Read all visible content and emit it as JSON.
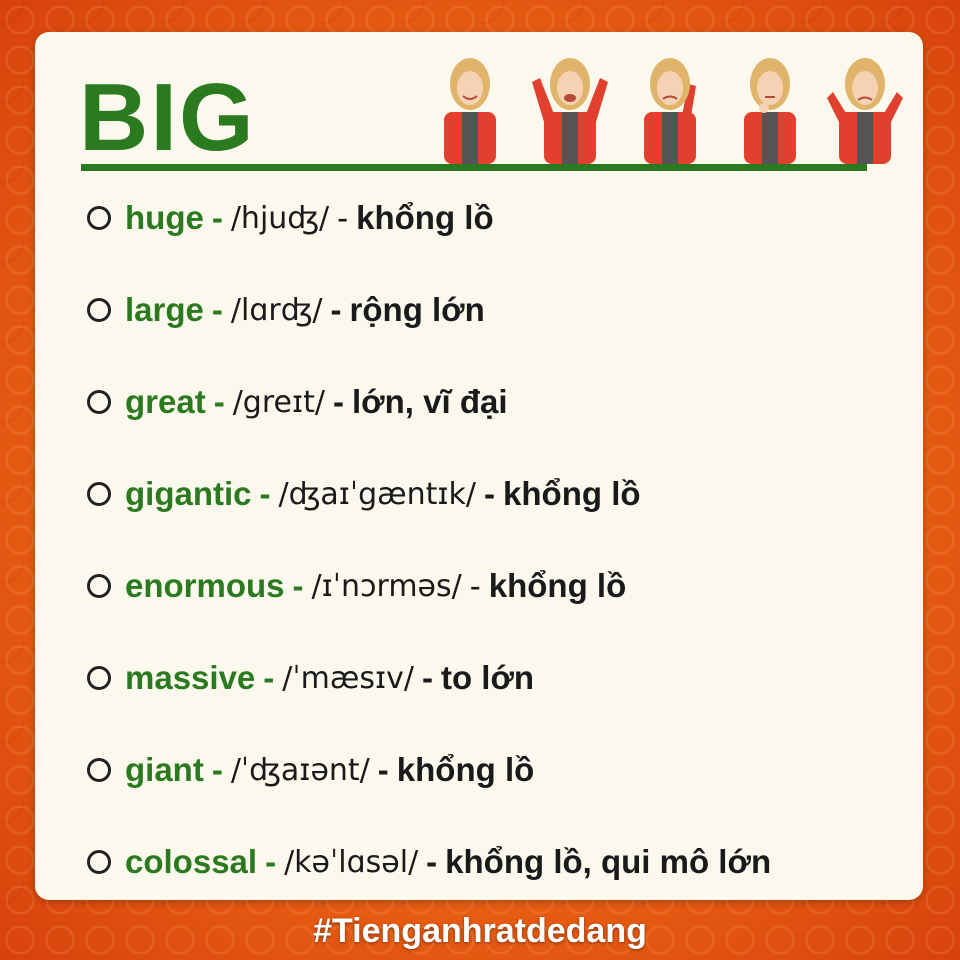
{
  "title": "BIG",
  "colors": {
    "accent": "#2c7a1f",
    "jacket": "#e2402e",
    "background": "#ee6a17",
    "card": "#fbf8ee"
  },
  "items": [
    {
      "word": "huge",
      "ipa": "/hjuʤ/",
      "meaning": "khổng lồ"
    },
    {
      "word": "large",
      "ipa": "/lɑrʤ/",
      "meaning": "rộng lớn"
    },
    {
      "word": "great",
      "ipa": "/greɪt/",
      "meaning": "lớn, vĩ đại"
    },
    {
      "word": "gigantic",
      "ipa": "/ʤaɪˈgæntɪk/",
      "meaning": "khổng lồ"
    },
    {
      "word": "enormous",
      "ipa": "/ɪˈnɔrməs/",
      "meaning": "khổng lồ"
    },
    {
      "word": "massive",
      "ipa": "/ˈmæsɪv/",
      "meaning": "to lớn"
    },
    {
      "word": "giant",
      "ipa": "/ˈʤaɪənt/",
      "meaning": "khổng lồ"
    },
    {
      "word": "colossal",
      "ipa": "/kəˈlɑsəl/",
      "meaning": "khổng lồ, qui mô lớn"
    }
  ],
  "hashtag": "#Tienganhratdedang"
}
